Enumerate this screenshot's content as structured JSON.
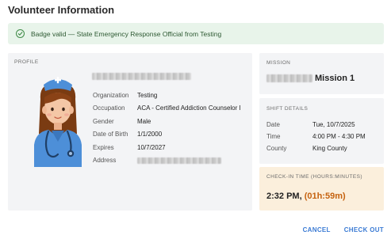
{
  "dialog": {
    "title": "Volunteer Information"
  },
  "banner": {
    "text": "Badge valid — State Emergency Response Official from Testing",
    "icon": "check-circle-icon",
    "color": "#2e7d32"
  },
  "profile": {
    "section_label": "PROFILE",
    "avatar_icon": "nurse-avatar-icon",
    "fields": [
      {
        "label": "Organization",
        "value": "Testing"
      },
      {
        "label": "Occupation",
        "value": "ACA - Certified Addiction Counselor I"
      },
      {
        "label": "Gender",
        "value": "Male"
      },
      {
        "label": "Date of Birth",
        "value": "1/1/2000"
      },
      {
        "label": "Expires",
        "value": "10/7/2027"
      },
      {
        "label": "Address",
        "value": ""
      }
    ]
  },
  "mission": {
    "section_label": "MISSION",
    "name_suffix": "Mission 1"
  },
  "shift": {
    "section_label": "SHIFT DETAILS",
    "rows": [
      {
        "label": "Date",
        "value": "Tue, 10/7/2025"
      },
      {
        "label": "Time",
        "value": "4:00 PM - 4:30 PM"
      },
      {
        "label": "County",
        "value": "King County"
      }
    ]
  },
  "checkin": {
    "section_label": "CHECK-IN TIME (HOURS:MINUTES)",
    "time": "2:32 PM, ",
    "duration": "(01h:59m)",
    "duration_color": "#c5620f"
  },
  "actions": {
    "cancel": "CANCEL",
    "checkout": "CHECK OUT"
  },
  "colors": {
    "accent": "#3b7bd4",
    "success_bg": "#e8f4ea",
    "warning_bg": "#fbefdc"
  }
}
